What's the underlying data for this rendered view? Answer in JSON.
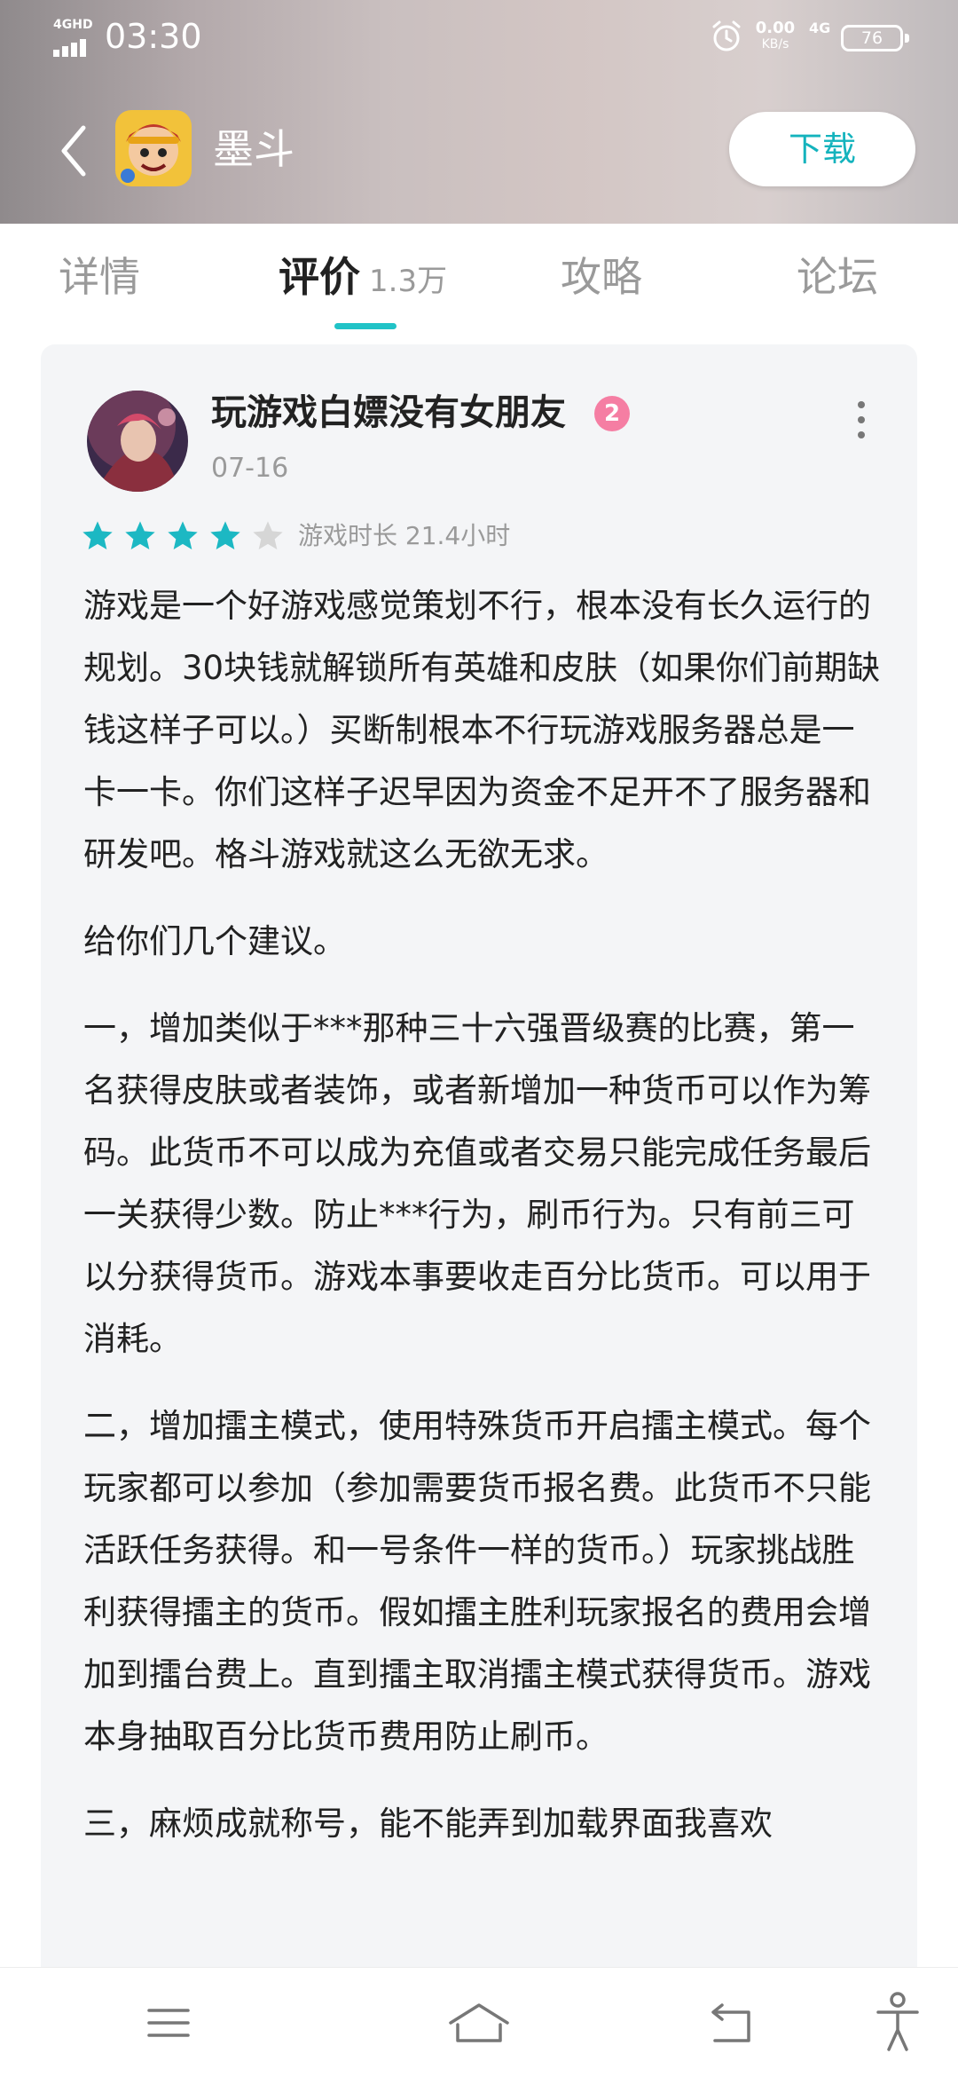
{
  "status_bar": {
    "network_label": "4GHD",
    "time": "03:30",
    "speed_value": "0.00",
    "speed_unit": "KB/s",
    "network_type": "4G",
    "battery": "76"
  },
  "header": {
    "app_name": "墨斗",
    "download_label": "下载"
  },
  "tabs": [
    {
      "label": "详情"
    },
    {
      "label": "评价",
      "count": "1.3万",
      "active": true
    },
    {
      "label": "攻略"
    },
    {
      "label": "论坛"
    }
  ],
  "review": {
    "username": "玩游戏白嫖没有女朋友",
    "level": "2",
    "date": "07-16",
    "rating": 4,
    "rating_max": 5,
    "playtime": "游戏时长 21.4小时",
    "paragraphs": [
      "游戏是一个好游戏感觉策划不行，根本没有长久运行的规划。30块钱就解锁所有英雄和皮肤（如果你们前期缺钱这样子可以。）买断制根本不行玩游戏服务器总是一卡一卡。你们这样子迟早因为资金不足开不了服务器和研发吧。格斗游戏就这么无欲无求。",
      "给你们几个建议。",
      "一，增加类似于***那种三十六强晋级赛的比赛，第一名获得皮肤或者装饰，或者新增加一种货币可以作为筹码。此货币不可以成为充值或者交易只能完成任务最后一关获得少数。防止***行为，刷币行为。只有前三可以分获得货币。游戏本事要收走百分比货币。可以用于消耗。",
      "二，增加擂主模式，使用特殊货币开启擂主模式。每个玩家都可以参加（参加需要货币报名费。此货币不只能活跃任务获得。和一号条件一样的货币。）玩家挑战胜利获得擂主的货币。假如擂主胜利玩家报名的费用会增加到擂台费上。直到擂主取消擂主模式获得货币。游戏本身抽取百分比货币费用防止刷币。",
      "三，麻烦成就称号，能不能弄到加载界面我喜欢"
    ]
  },
  "colors": {
    "accent": "#21c3c7",
    "download_text": "#14b3bd",
    "badge": "#f57ea3",
    "star_on": "#1cb8c3",
    "star_off": "#d6d6d6"
  },
  "icons": {
    "back": "chevron-left-icon",
    "menu": "menu-icon",
    "home": "home-icon",
    "return": "return-icon",
    "accessibility": "accessibility-icon",
    "more": "more-vertical-icon"
  }
}
